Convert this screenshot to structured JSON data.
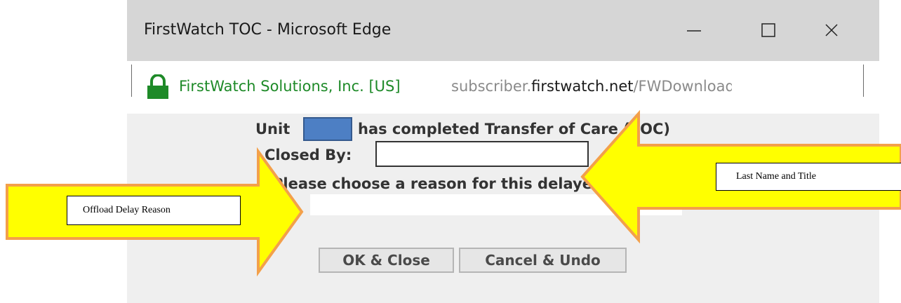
{
  "window": {
    "title": "FirstWatch TOC - Microsoft Edge",
    "controls": [
      "minimize-icon",
      "maximize-icon",
      "close-icon"
    ]
  },
  "address_bar": {
    "certificate_owner": "FirstWatch Solutions, Inc. [US]",
    "url_prefix": "subscriber.",
    "url_host": "firstwatch.net",
    "url_path": "/FWDownload/FWTOC"
  },
  "dialog": {
    "unit_prefix": "Unit",
    "unit_suffix": "has completed Transfer of Care (TOC)",
    "closed_by_label": "Closed By:",
    "closed_by_value": "",
    "reason_label": "Please choose a reason for this delayed TOC:",
    "reason_selected": "",
    "ok_button": "OK & Close",
    "cancel_button": "Cancel & Undo"
  },
  "annotations": {
    "closed_by_callout": "Last Name and Title",
    "reason_callout": "Offload Delay Reason"
  },
  "colors": {
    "arrow_fill": "#ffff00",
    "arrow_stroke": "#f3a04a",
    "lock_green": "#1e8a28",
    "unit_redaction": "#4d7fc4"
  }
}
